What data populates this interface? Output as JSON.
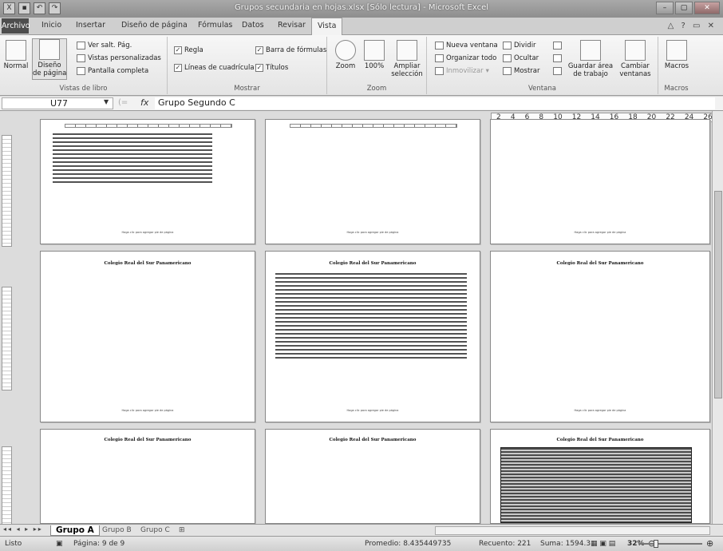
{
  "title_bar": {
    "title": "Grupos secundaria en hojas.xlsx  [Sólo lectura]  -  Microsoft Excel",
    "controls": [
      "–",
      "▢",
      "✕"
    ]
  },
  "tabs": [
    "Archivo",
    "Inicio",
    "Insertar",
    "Diseño de página",
    "Fórmulas",
    "Datos",
    "Revisar",
    "Vista"
  ],
  "active_tab": "Vista",
  "ribbon": {
    "vistas": {
      "group_label": "Vistas de libro",
      "normal": "Normal",
      "diseno": "Diseño\nde página",
      "ver_salt": "Ver salt. Pág.",
      "personalizadas": "Vistas personalizadas",
      "pantalla": "Pantalla completa"
    },
    "mostrar": {
      "group_label": "Mostrar",
      "regla": "Regla",
      "lineas": "Líneas de cuadrícula",
      "barra": "Barra de fórmulas",
      "titulos": "Títulos"
    },
    "zoom": {
      "group_label": "Zoom",
      "zoom": "Zoom",
      "cien": "100%",
      "ampliar": "Ampliar\nselección"
    },
    "ventana": {
      "group_label": "Ventana",
      "nueva": "Nueva ventana",
      "organizar": "Organizar todo",
      "inmovilizar": "Inmovilizar",
      "dividir": "Dividir",
      "ocultar": "Ocultar",
      "mostrar": "Mostrar",
      "guardar": "Guardar área\nde trabajo",
      "cambiar": "Cambiar\nventanas"
    },
    "macros": {
      "group_label": "Macros",
      "macros": "Macros"
    }
  },
  "formula_bar": {
    "name_box": "U77",
    "fx": "fx",
    "value": "Grupo Segundo C"
  },
  "ruler_ticks": [
    "2",
    "4",
    "6",
    "8",
    "10",
    "12",
    "14",
    "16",
    "18",
    "20",
    "22",
    "24",
    "26"
  ],
  "pages": {
    "header": "Colegio Real del Sur Panamericano",
    "footer": "Haga clic para agregar pie de página"
  },
  "sheets": [
    "Grupo A",
    "Grupo B",
    "Grupo C"
  ],
  "status": {
    "ready": "Listo",
    "page": "Página: 9 de 9",
    "promedio": "Promedio: 8.435449735",
    "recuento": "Recuento: 221",
    "suma": "Suma: 1594.3",
    "zoom": "32%"
  }
}
